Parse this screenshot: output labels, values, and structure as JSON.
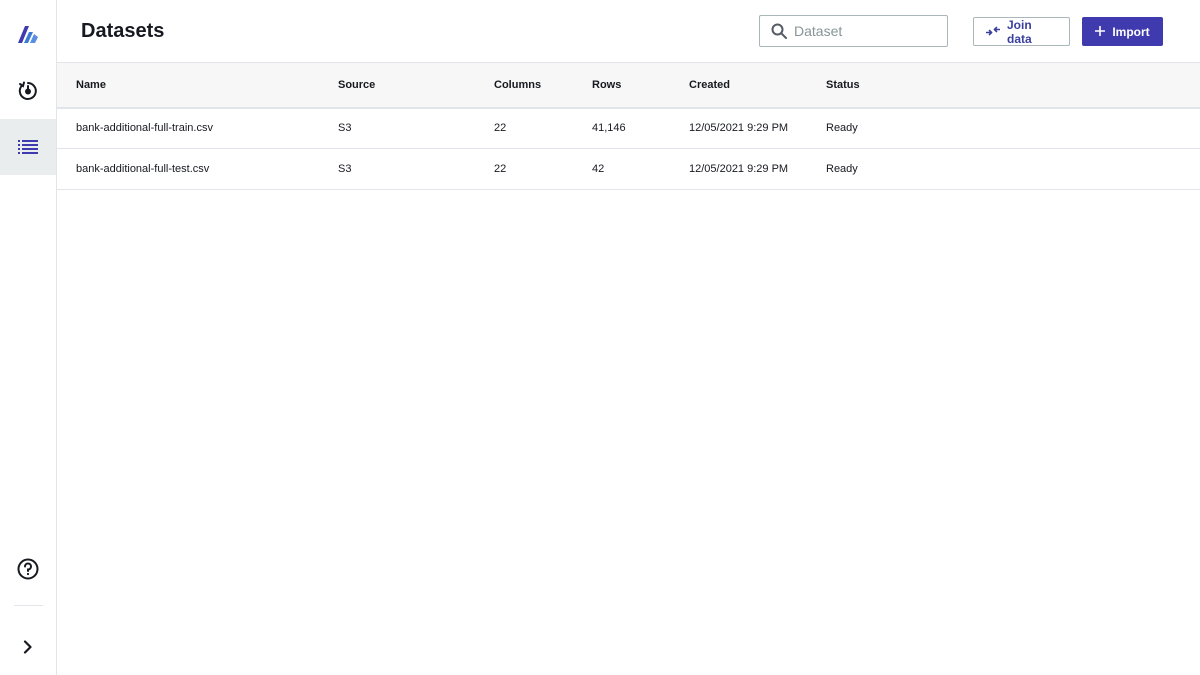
{
  "sidebar": {
    "items": [
      {
        "name": "logo",
        "icon": "app-logo-icon"
      },
      {
        "name": "refresh",
        "icon": "refresh-icon"
      },
      {
        "name": "datasets",
        "icon": "list-icon",
        "active": true
      },
      {
        "name": "help",
        "icon": "help-icon"
      },
      {
        "name": "expand",
        "icon": "chevron-right-icon"
      }
    ]
  },
  "header": {
    "title": "Datasets",
    "search": {
      "placeholder": "Dataset",
      "value": ""
    },
    "join_label": "Join data",
    "import_label": "Import"
  },
  "table": {
    "columns": [
      "Name",
      "Source",
      "Columns",
      "Rows",
      "Created",
      "Status"
    ],
    "rows": [
      [
        "bank-additional-full-train.csv",
        "S3",
        "22",
        "41,146",
        "12/05/2021 9:29 PM",
        "Ready"
      ],
      [
        "bank-additional-full-test.csv",
        "S3",
        "22",
        "42",
        "12/05/2021 9:29 PM",
        "Ready"
      ]
    ]
  },
  "colors": {
    "accent": "#3f3aad",
    "logo_primary": "#3f3aad",
    "logo_secondary": "#3a7bd5",
    "icon": "#16191f",
    "active_nav_icon": "#3f3aad",
    "border": "#e1e4e8"
  }
}
